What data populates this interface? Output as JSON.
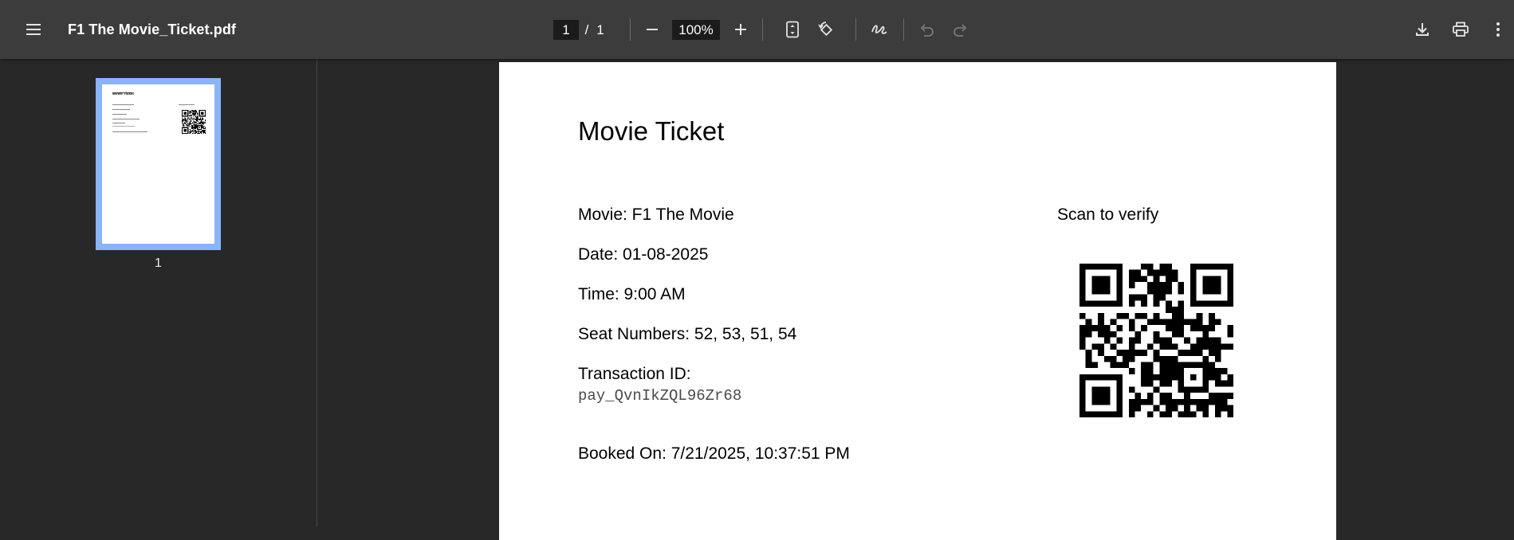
{
  "toolbar": {
    "menu_icon": "hamburger-menu-icon",
    "file_title": "F1 The Movie_Ticket.pdf",
    "current_page": "1",
    "page_separator": "/",
    "total_pages": "1",
    "zoom_level": "100%",
    "icons": [
      "zoom-out-icon",
      "zoom-in-icon",
      "fit-page-icon",
      "rotate-icon",
      "annotate-pen-icon",
      "undo-icon",
      "redo-icon",
      "download-icon",
      "print-icon",
      "more-options-icon"
    ]
  },
  "sidebar": {
    "thumbnails": [
      {
        "label": "1",
        "selected": true
      }
    ]
  },
  "document": {
    "title": "Movie Ticket",
    "movie": "Movie: F1 The Movie",
    "date": "Date: 01-08-2025",
    "time": "Time: 9:00 AM",
    "seats": "Seat Numbers: 52, 53, 51, 54",
    "transaction_label": "Transaction ID:",
    "transaction_id": "pay_QvnIkZQL96Zr68",
    "booked_on": "Booked On: 7/21/2025, 10:37:51 PM",
    "scan_label": "Scan to verify"
  },
  "colors": {
    "toolbar_bg": "#3c3c3c",
    "viewer_bg": "#282828",
    "thumbnail_selection": "#8ab4f8"
  }
}
